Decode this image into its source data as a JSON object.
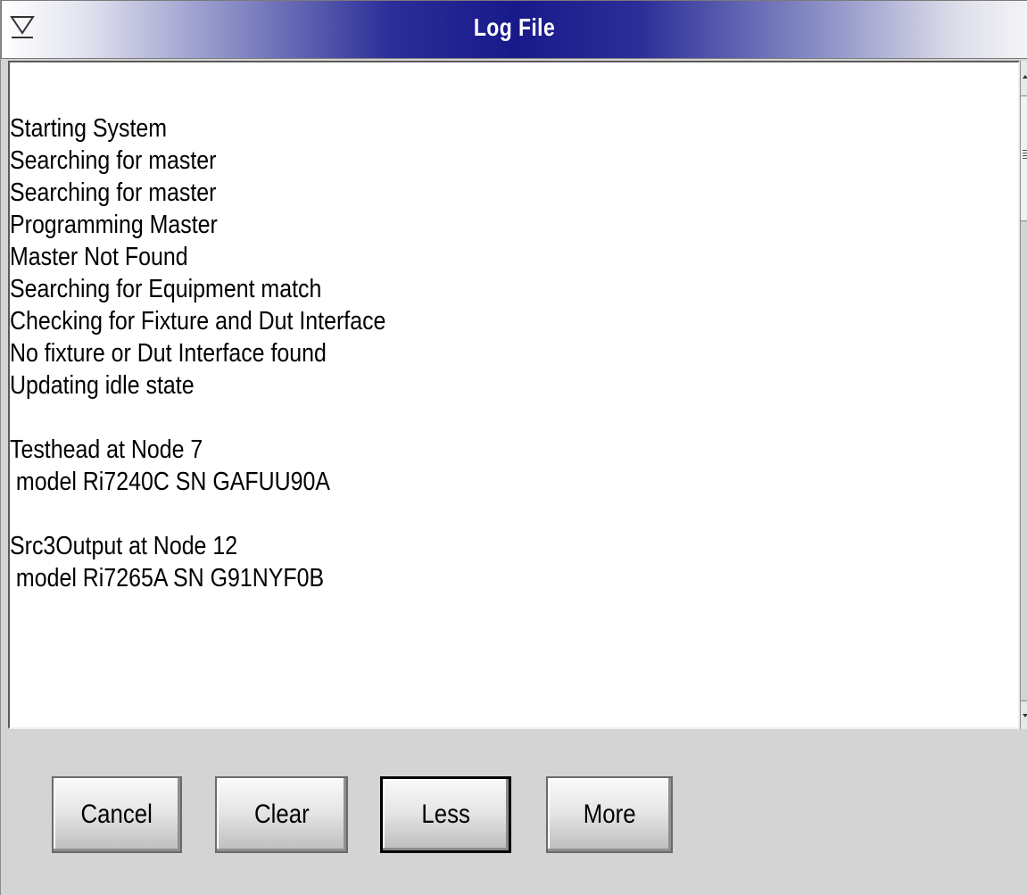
{
  "window": {
    "title": "Log File",
    "menu_icon": "window-menu-triangle-icon"
  },
  "log": {
    "lines": [
      "Starting System",
      "Searching for master",
      "Searching for master",
      "Programming Master",
      "Master Not Found",
      "Searching for Equipment match",
      "Checking for Fixture and Dut Interface",
      "No fixture or Dut Interface found",
      "Updating idle state",
      "",
      "Testhead at Node 7",
      " model Ri7240C SN GAFUU90A",
      "",
      "Src3Output at Node 12",
      " model Ri7265A SN G91NYF0B"
    ]
  },
  "buttons": {
    "cancel": "Cancel",
    "clear": "Clear",
    "less": "Less",
    "more": "More"
  },
  "colors": {
    "titlebar_accent": "#181a8a",
    "background": "#d4d4d4"
  }
}
